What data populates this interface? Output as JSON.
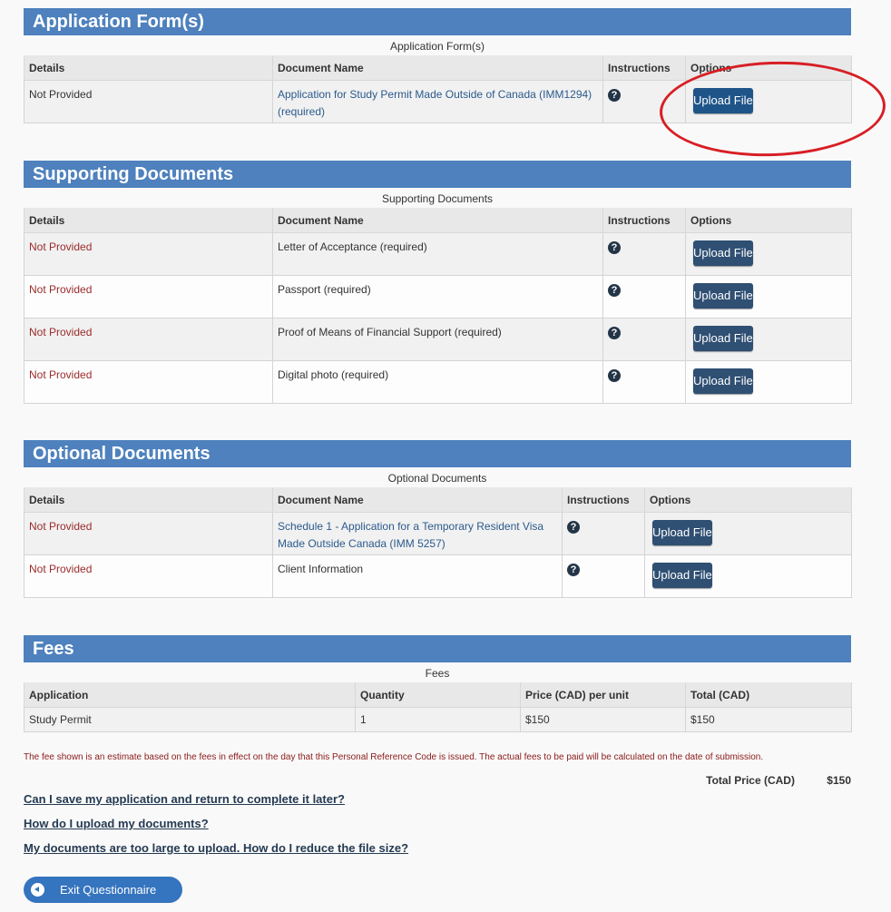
{
  "sections": {
    "application_forms": {
      "title": "Application Form(s)",
      "caption": "Application Form(s)",
      "headers": [
        "Details",
        "Document Name",
        "Instructions",
        "Options"
      ],
      "rows": [
        {
          "details": "Not Provided",
          "document_name": "Application for Study Permit Made Outside of Canada (IMM1294)  (required)",
          "instructions_icon": "question-circle-icon",
          "button_label": "Upload File"
        }
      ]
    },
    "supporting_documents": {
      "title": "Supporting Documents",
      "caption": "Supporting Documents",
      "headers": [
        "Details",
        "Document Name",
        "Instructions",
        "Options"
      ],
      "rows": [
        {
          "details": "Not Provided",
          "document_name": "Letter of Acceptance  (required)",
          "instructions_icon": "question-circle-icon",
          "button_label": "Upload File"
        },
        {
          "details": "Not Provided",
          "document_name": "Passport  (required)",
          "instructions_icon": "question-circle-icon",
          "button_label": "Upload File"
        },
        {
          "details": "Not Provided",
          "document_name": "Proof of Means of Financial Support  (required)",
          "instructions_icon": "question-circle-icon",
          "button_label": "Upload File"
        },
        {
          "details": "Not Provided",
          "document_name": "Digital photo  (required)",
          "instructions_icon": "question-circle-icon",
          "button_label": "Upload File"
        }
      ]
    },
    "optional_documents": {
      "title": "Optional Documents",
      "caption": "Optional Documents",
      "headers": [
        "Details",
        "Document Name",
        "Instructions",
        "Options"
      ],
      "rows": [
        {
          "details": "Not Provided",
          "document_name": "Schedule 1 - Application for a Temporary Resident Visa Made Outside Canada (IMM 5257)",
          "instructions_icon": "question-circle-icon",
          "button_label": "Upload File"
        },
        {
          "details": "Not Provided",
          "document_name": "Client Information",
          "instructions_icon": "question-circle-icon",
          "button_label": "Upload File"
        }
      ]
    },
    "fees": {
      "title": "Fees",
      "caption": "Fees",
      "headers": [
        "Application",
        "Quantity",
        "Price (CAD) per unit",
        "Total (CAD)"
      ],
      "rows": [
        {
          "application": "Study Permit",
          "quantity": "1",
          "price": "$150",
          "total": "$150"
        }
      ]
    }
  },
  "fee_note": "The fee shown is an estimate based on the fees in effect on the day that this Personal Reference Code is issued. The actual fees to be paid will be calculated on the date of submission.",
  "total": {
    "label": "Total Price (CAD)",
    "value": "$150"
  },
  "help_links": [
    "Can I save my application and return to complete it later?",
    "How do I upload my documents?",
    "My documents are too large to upload. How do I reduce the file size?"
  ],
  "exit_button": {
    "label": "Exit Questionnaire",
    "icon": "back-arrow-circle-icon"
  },
  "help_icon_glyph": "?",
  "colors": {
    "section_header": "#4e81bd",
    "upload_button": "#2f4f73",
    "upload_button_highlighted": "#1f5489",
    "not_provided_red": "#9b2b2b",
    "annotation_ellipse": "#d81e25",
    "exit_button": "#3574be"
  }
}
